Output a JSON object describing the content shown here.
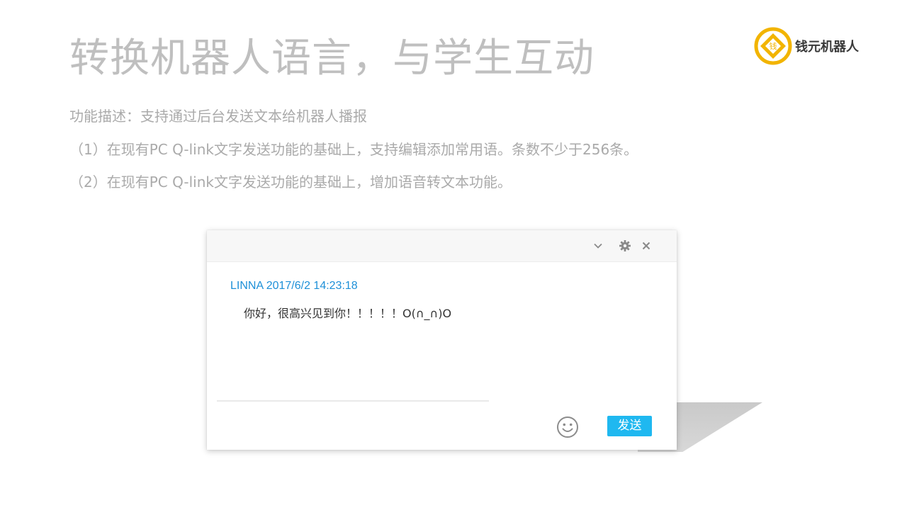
{
  "slide": {
    "title": "转换机器人语言，与学生互动",
    "description_lines": [
      "功能描述：支持通过后台发送文本给机器人播报",
      "（1）在现有PC Q-link文字发送功能的基础上，支持编辑添加常用语。条数不少于256条。",
      "（2）在现有PC Q-link文字发送功能的基础上，增加语音转文本功能。"
    ]
  },
  "brand": {
    "name": "钱元机器人",
    "logo_text": "钱",
    "logo_color": "#f2b400"
  },
  "chat": {
    "titlebar_icons": [
      "chevron-down-icon",
      "gear-icon",
      "close-icon"
    ],
    "message": {
      "sender_time": "LINNA 2017/6/2 14:23:18",
      "text": "你好，很高兴见到你！！！！！O(∩_∩)O"
    },
    "emoji_icon": "smiley-icon",
    "send_label": "发送",
    "accent_color": "#1fb8f0",
    "sender_color": "#1e90d8"
  }
}
